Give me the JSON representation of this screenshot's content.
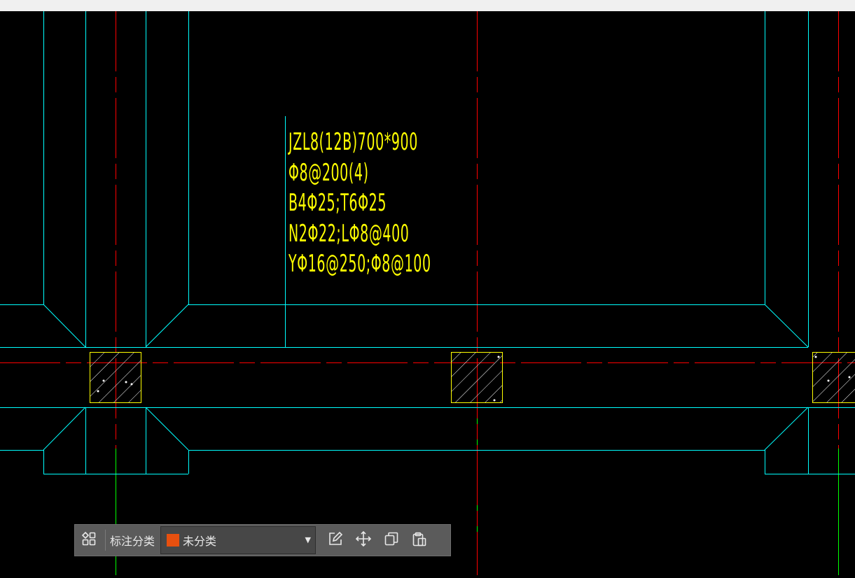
{
  "drawing": {
    "annotation_lines": [
      "JZL8(12B)700*900",
      "Φ8@200(4)",
      "B4Φ25;T6Φ25",
      "N2Φ22;LΦ8@400",
      "YΦ16@250;Φ8@100"
    ],
    "colors": {
      "background": "#000000",
      "outline": "#00ffff",
      "axis": "#ff0000",
      "annotation": "#ffff00",
      "grid_green": "#00ff00",
      "hatch": "#ffffff"
    }
  },
  "toolbar": {
    "category_label": "标注分类",
    "selected_category": "未分类",
    "swatch_color": "#e8500f",
    "icons": [
      "grid-icon",
      "edit-icon",
      "move-icon",
      "copy-icon",
      "paste-icon"
    ]
  }
}
